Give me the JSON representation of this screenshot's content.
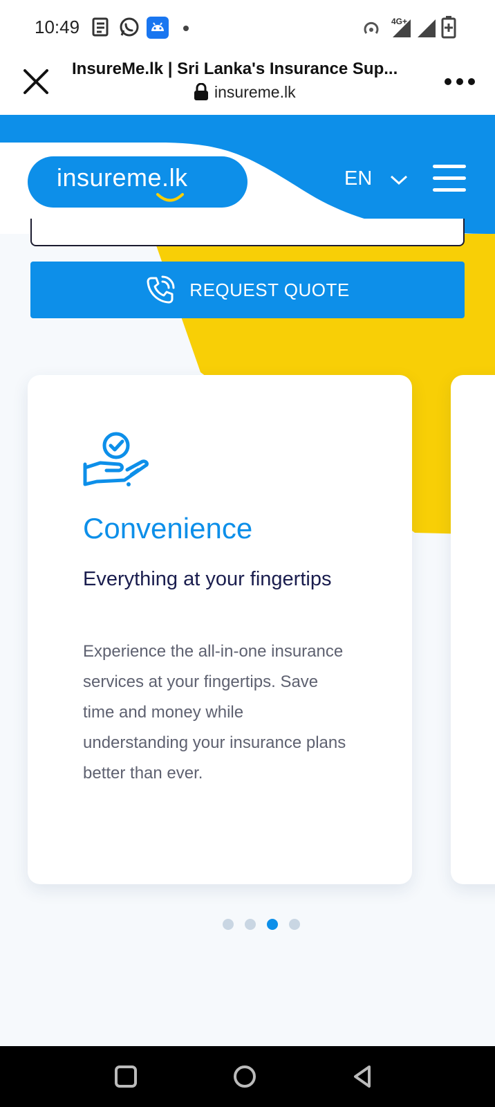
{
  "status_bar": {
    "time": "10:49",
    "network_label": "4G+",
    "icons": [
      "news-icon",
      "whatsapp-icon",
      "android-icon",
      "dot-icon",
      "hotspot-icon",
      "signal-icon",
      "signal-icon",
      "battery-charging-icon"
    ]
  },
  "browser": {
    "page_title": "InsureMe.lk | Sri Lanka's Insurance Sup...",
    "url": "insureme.lk",
    "close_icon": "close-icon",
    "lock_icon": "lock-icon",
    "more_icon": "more-icon"
  },
  "header": {
    "logo_text": "insureme.lk",
    "language": "EN",
    "menu_icon": "hamburger-icon"
  },
  "quote_button": {
    "label": "REQUEST QUOTE",
    "icon": "phone-call-icon"
  },
  "card": {
    "icon": "hand-check-icon",
    "title": "Convenience",
    "subtitle": "Everything at your fingertips",
    "body": "Experience the all-in-one insurance services at your fingertips. Save time and money while understanding your insurance plans better than ever."
  },
  "carousel": {
    "total_slides": 4,
    "active_index": 2
  },
  "navbar": {
    "icons": [
      "recents-icon",
      "home-icon",
      "back-icon"
    ]
  },
  "colors": {
    "brand_blue": "#0d8fe9",
    "brand_yellow": "#f8cf06",
    "heading_navy": "#1a1d4e",
    "body_gray": "#5e6170"
  }
}
